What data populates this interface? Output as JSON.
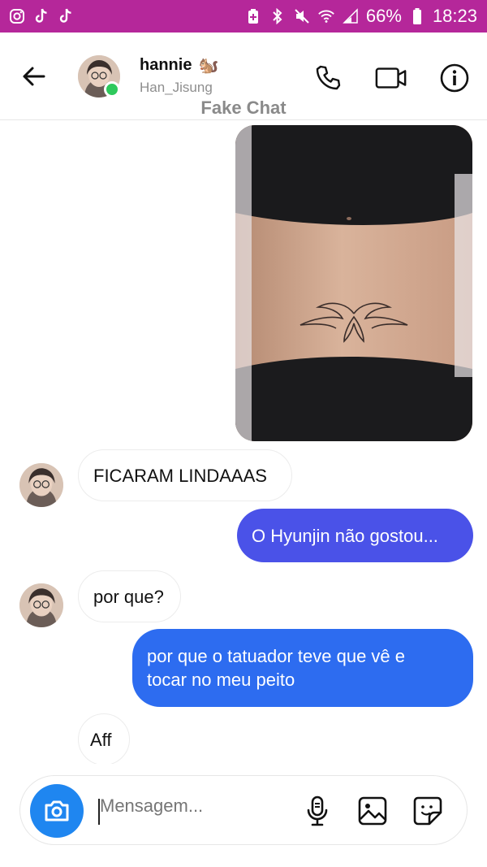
{
  "status_bar": {
    "left_icons": [
      "instagram-icon",
      "tiktok-icon",
      "tiktok-icon"
    ],
    "right_icons": [
      "battery-saver-icon",
      "bluetooth-icon",
      "mute-icon",
      "wifi-icon",
      "signal-icon",
      "battery-icon"
    ],
    "battery": "66%",
    "time": "18:23",
    "color": "#b5279a"
  },
  "header": {
    "contact_name": "hannie",
    "name_emoji": "🐿️",
    "handle": "Han_Jisung",
    "watermark": "Fake Chat",
    "icons": [
      "back-arrow-icon",
      "phone-icon",
      "video-camera-icon",
      "info-icon"
    ],
    "online_color": "#2ec95c"
  },
  "messages": [
    {
      "direction": "outgoing",
      "type": "image",
      "description_icon": "tattoo-photo"
    },
    {
      "direction": "incoming",
      "text": "FICARAM LINDAAAS"
    },
    {
      "direction": "outgoing",
      "text": "O Hyunjin não gostou...",
      "color": "#4a52e8"
    },
    {
      "direction": "incoming",
      "text": "por que?"
    },
    {
      "direction": "outgoing",
      "text_lines": [
        "por que o tatuador teve que vê e",
        "tocar no meu peito"
      ],
      "color": "#2d6cf0"
    },
    {
      "direction": "incoming",
      "text": "Aff"
    }
  ],
  "composer": {
    "placeholder": "Mensagem...",
    "icons": [
      "camera-icon",
      "microphone-icon",
      "gallery-icon",
      "sticker-icon"
    ],
    "camera_color": "#1f86f0"
  }
}
